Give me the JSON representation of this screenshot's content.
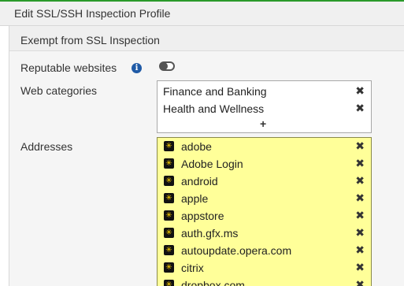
{
  "window": {
    "title": "Edit SSL/SSH Inspection Profile"
  },
  "section": {
    "title": "Exempt from SSL Inspection"
  },
  "reputable": {
    "label": "Reputable websites",
    "info_icon": "i",
    "toggle_on": false
  },
  "web_categories": {
    "label": "Web categories",
    "items": [
      "Finance and Banking",
      "Health and Wellness"
    ],
    "add_symbol": "+"
  },
  "addresses": {
    "label": "Addresses",
    "icon_glyph": "✳",
    "items": [
      "adobe",
      "Adobe Login",
      "android",
      "apple",
      "appstore",
      "auth.gfx.ms",
      "autoupdate.opera.com",
      "citrix",
      "dropbox.com"
    ]
  },
  "remove_symbol": "✖",
  "colors": {
    "accent": "#2a9a2a",
    "address_bg": "#ffff99",
    "info": "#1f5aa6"
  }
}
